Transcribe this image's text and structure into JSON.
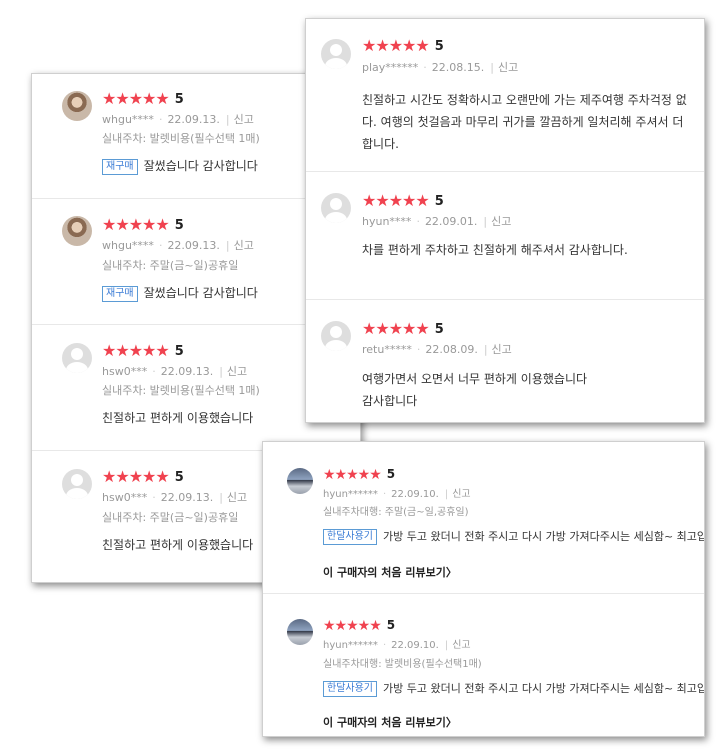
{
  "left_card": {
    "reviews": [
      {
        "user": "whgu****",
        "date": "22.09.13.",
        "report": "신고",
        "option": "실내주차: 발렛비용(필수선택 1매)",
        "badge": "재구매",
        "text": "잘썼습니다 감사합니다",
        "rating": "5"
      },
      {
        "user": "whgu****",
        "date": "22.09.13.",
        "report": "신고",
        "option": "실내주차: 주말(금~일)공휴일",
        "badge": "재구매",
        "text": "잘썼습니다 감사합니다",
        "rating": "5"
      },
      {
        "user": "hsw0***",
        "date": "22.09.13.",
        "report": "신고",
        "option": "실내주차: 발렛비용(필수선택 1매)",
        "text": "친절하고 편하게 이용했습니다",
        "rating": "5"
      },
      {
        "user": "hsw0***",
        "date": "22.09.13.",
        "report": "신고",
        "option": "실내주차: 주말(금~일)공휴일",
        "text": "친절하고 편하게 이용했습니다",
        "rating": "5"
      }
    ]
  },
  "top_card": {
    "reviews": [
      {
        "user": "play******",
        "date": "22.08.15.",
        "report": "신고",
        "rating": "5",
        "lines": [
          "친절하고 시간도 정확하시고 오랜만에 가는 제주여행 주차걱정 없",
          "다. 여행의 첫걸음과 마무리 귀가를 깔끔하게 일처리해 주셔서 더",
          "합니다."
        ]
      },
      {
        "user": "hyun****",
        "date": "22.09.01.",
        "report": "신고",
        "rating": "5",
        "lines": [
          "차를 편하게 주차하고 친절하게 해주셔서 감사합니다."
        ]
      },
      {
        "user": "retu*****",
        "date": "22.08.09.",
        "report": "신고",
        "rating": "5",
        "lines": [
          "여행가면서 오면서 너무 편하게 이용했습니다",
          "감사합니다"
        ]
      }
    ]
  },
  "bottom_card": {
    "reviews": [
      {
        "user": "hyun******",
        "date": "22.09.10.",
        "report": "신고",
        "rating": "5",
        "option": "실내주차대행: 주말(금~일,공휴일)",
        "badge": "한달사용기",
        "text": "가방 두고 왔더니 전화 주시고 다시 가방 가져다주시는 세심함~ 최고입",
        "more": "이 구매자의 처음 리뷰보기"
      },
      {
        "user": "hyun******",
        "date": "22.09.10.",
        "report": "신고",
        "rating": "5",
        "option": "실내주차대행: 발렛비용(필수선택1매)",
        "badge": "한달사용기",
        "text": "가방 두고 왔더니 전화 주시고 다시 가방 가져다주시는 세심함~ 최고입",
        "more": "이 구매자의 처음 리뷰보기"
      }
    ]
  },
  "icons": {
    "star": "star-icon",
    "more_arrow": "chevron-right-icon",
    "avatar": "avatar"
  },
  "colors": {
    "star": "#f0424f",
    "badge": "#3a7bd5"
  }
}
